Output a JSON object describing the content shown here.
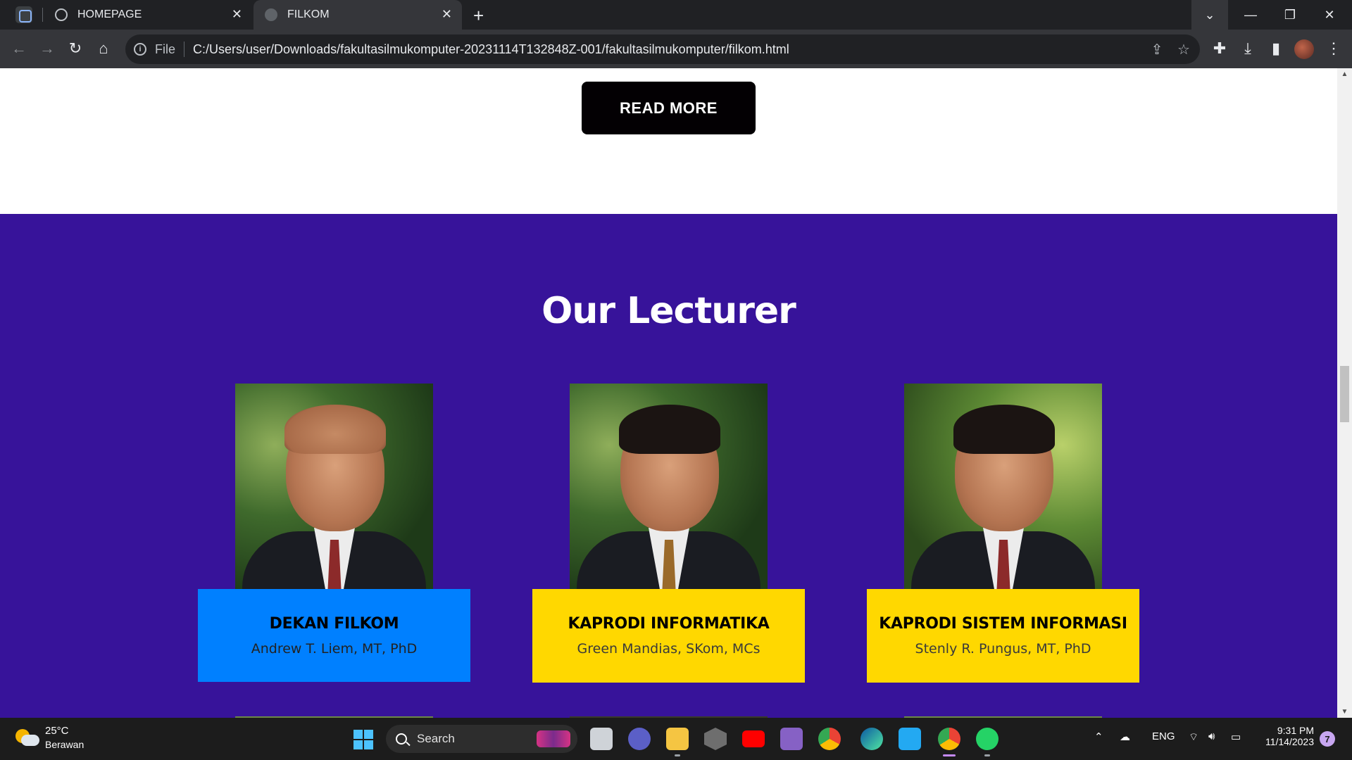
{
  "browser": {
    "tabs": [
      {
        "label": "HOMEPAGE",
        "active": false
      },
      {
        "label": "FILKOM",
        "active": true
      }
    ],
    "address": {
      "scheme": "File",
      "url": "C:/Users/user/Downloads/fakultasilmukomputer-20231114T132848Z-001/fakultasilmukomputer/filkom.html"
    }
  },
  "page": {
    "read_more_label": "READ MORE",
    "section_title": "Our Lecturer",
    "lecturers": [
      {
        "role": "DEKAN FILKOM",
        "name": "Andrew T. Liem, MT, PhD",
        "card_color": "#0080ff"
      },
      {
        "role": "KAPRODI INFORMATIKA",
        "name": "Green Mandias, SKom, MCs",
        "card_color": "#ffd800"
      },
      {
        "role": "KAPRODI SISTEM INFORMASI",
        "name": "Stenly R. Pungus, MT, PhD",
        "card_color": "#ffd800"
      }
    ],
    "colors": {
      "section_bg": "#37139a",
      "button_bg": "#030003"
    }
  },
  "taskbar": {
    "weather": {
      "temp": "25°C",
      "condition": "Berawan"
    },
    "search_label": "Search",
    "tray": {
      "language": "ENG"
    },
    "clock": {
      "time": "9:31 PM",
      "date": "11/14/2023"
    },
    "notification_count": "7"
  }
}
